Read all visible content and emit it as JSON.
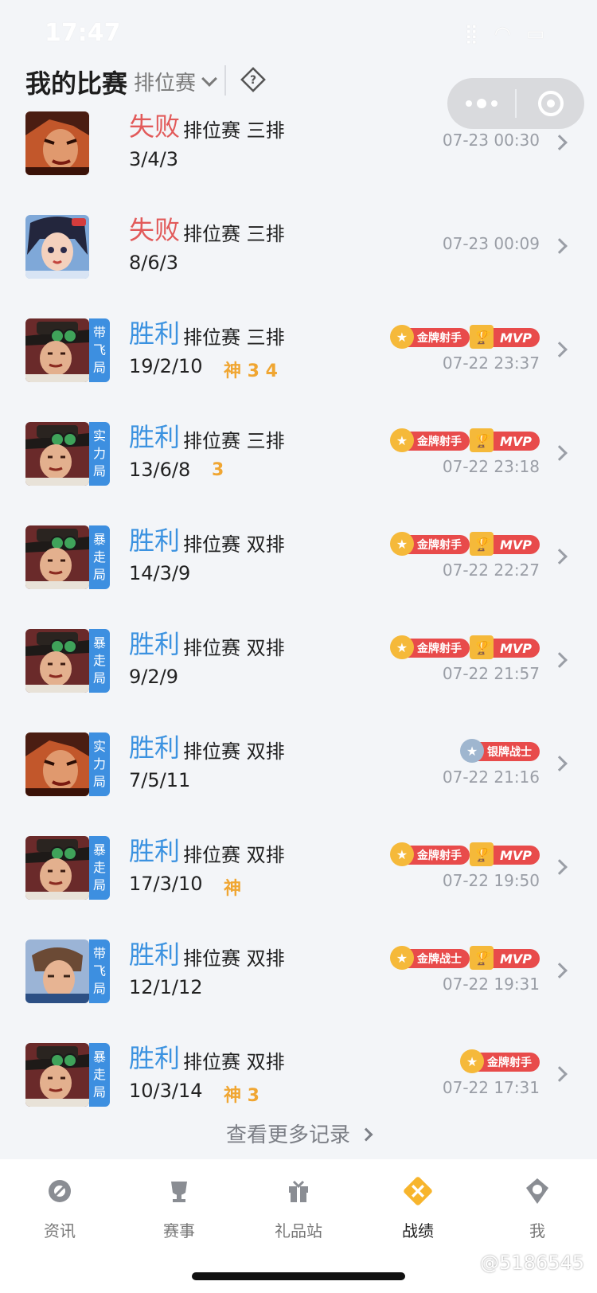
{
  "status_bar": {
    "time": "17:47",
    "icons": "⣿ ◠ ▭"
  },
  "header": {
    "title": "我的比赛",
    "filter": "排位赛"
  },
  "capsule": {
    "more_icon": "more-dots-icon",
    "close_icon": "target-icon"
  },
  "matches": [
    {
      "hero": "red",
      "tag": "",
      "result": "失败",
      "outcome": "loss",
      "mode": "排位赛 三排",
      "kda": "3/4/3",
      "honor": "",
      "badges": [],
      "time": "07-23 00:30"
    },
    {
      "hero": "girl",
      "tag": "",
      "result": "失败",
      "outcome": "loss",
      "mode": "排位赛 三排",
      "kda": "8/6/3",
      "honor": "",
      "badges": [],
      "time": "07-23 00:09"
    },
    {
      "hero": "hat",
      "tag": "带飞局",
      "result": "胜利",
      "outcome": "win",
      "mode": "排位赛 三排",
      "kda": "19/2/10",
      "honor": "神 3 4",
      "badges": [
        "金牌射手",
        "MVP"
      ],
      "time": "07-22 23:37"
    },
    {
      "hero": "hat",
      "tag": "实力局",
      "result": "胜利",
      "outcome": "win",
      "mode": "排位赛 三排",
      "kda": "13/6/8",
      "honor": "3",
      "badges": [
        "金牌射手",
        "MVP"
      ],
      "time": "07-22 23:18"
    },
    {
      "hero": "hat",
      "tag": "暴走局",
      "result": "胜利",
      "outcome": "win",
      "mode": "排位赛 双排",
      "kda": "14/3/9",
      "honor": "",
      "badges": [
        "金牌射手",
        "MVP"
      ],
      "time": "07-22 22:27"
    },
    {
      "hero": "hat",
      "tag": "暴走局",
      "result": "胜利",
      "outcome": "win",
      "mode": "排位赛 双排",
      "kda": "9/2/9",
      "honor": "",
      "badges": [
        "金牌射手",
        "MVP"
      ],
      "time": "07-22 21:57"
    },
    {
      "hero": "red",
      "tag": "实力局",
      "result": "胜利",
      "outcome": "win",
      "mode": "排位赛 双排",
      "kda": "7/5/11",
      "honor": "",
      "badges": [
        "银牌战士"
      ],
      "time": "07-22 21:16"
    },
    {
      "hero": "hat",
      "tag": "暴走局",
      "result": "胜利",
      "outcome": "win",
      "mode": "排位赛 双排",
      "kda": "17/3/10",
      "honor": "神",
      "badges": [
        "金牌射手",
        "MVP"
      ],
      "time": "07-22 19:50"
    },
    {
      "hero": "blue",
      "tag": "带飞局",
      "result": "胜利",
      "outcome": "win",
      "mode": "排位赛 双排",
      "kda": "12/1/12",
      "honor": "",
      "badges": [
        "金牌战士",
        "MVP"
      ],
      "time": "07-22 19:31"
    },
    {
      "hero": "hat",
      "tag": "暴走局",
      "result": "胜利",
      "outcome": "win",
      "mode": "排位赛 双排",
      "kda": "10/3/14",
      "honor": "神 3",
      "badges": [
        "金牌射手"
      ],
      "time": "07-22 17:31"
    }
  ],
  "more_records": "查看更多记录",
  "tabbar": [
    {
      "label": "资讯",
      "icon": "news-icon",
      "active": false
    },
    {
      "label": "赛事",
      "icon": "trophy-icon",
      "active": false
    },
    {
      "label": "礼品站",
      "icon": "gift-icon",
      "active": false
    },
    {
      "label": "战绩",
      "icon": "record-icon",
      "active": true
    },
    {
      "label": "我",
      "icon": "profile-icon",
      "active": false
    }
  ],
  "watermark": "@5186545",
  "colors": {
    "win": "#3b92e0",
    "loss": "#e25a5a",
    "honor": "#f0a632",
    "tag": "#3d8fe0"
  }
}
